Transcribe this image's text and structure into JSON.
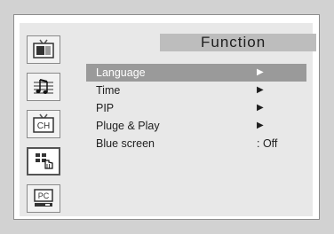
{
  "menu": {
    "title": "Function",
    "items": [
      {
        "label": "Language",
        "value": "▶",
        "selected": true
      },
      {
        "label": "Time",
        "value": "▶",
        "selected": false
      },
      {
        "label": "PIP",
        "value": "▶",
        "selected": false
      },
      {
        "label": "Pluge & Play",
        "value": "▶",
        "selected": false
      },
      {
        "label": "Blue screen",
        "value": ": Off",
        "selected": false
      }
    ]
  },
  "sidebar": {
    "items": [
      {
        "icon": "tv-picture-icon"
      },
      {
        "icon": "sound-icon"
      },
      {
        "icon": "channel-icon",
        "text": "CH"
      },
      {
        "icon": "function-icon",
        "active": true
      },
      {
        "icon": "pc-icon",
        "text": "PC"
      }
    ]
  },
  "colors": {
    "background": "#d2d2d2",
    "panel": "#e8e8e8",
    "title_bar": "#bdbdbd",
    "selection": "#9a9a9a"
  }
}
